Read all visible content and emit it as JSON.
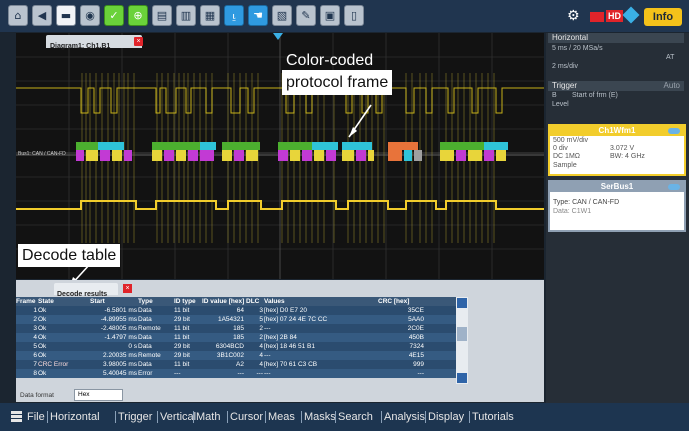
{
  "toolbar": {
    "buttons": [
      {
        "icon": "home-icon",
        "glyph": "⌂"
      },
      {
        "icon": "back-icon",
        "glyph": "◀"
      },
      {
        "icon": "folder-icon",
        "glyph": "▬"
      },
      {
        "icon": "camera-icon",
        "glyph": "◉"
      },
      {
        "icon": "autoset-icon",
        "glyph": "✓"
      },
      {
        "icon": "zoom-icon",
        "glyph": "⊕"
      },
      {
        "icon": "measure-icon",
        "glyph": "▤"
      },
      {
        "icon": "histogram-icon",
        "glyph": "▥"
      },
      {
        "icon": "copy-icon",
        "glyph": "▦"
      },
      {
        "icon": "cursor-icon",
        "glyph": "⍸"
      },
      {
        "icon": "hand-icon",
        "glyph": "☚"
      },
      {
        "icon": "mask-icon",
        "glyph": "▧"
      },
      {
        "icon": "draw-icon",
        "glyph": "✎"
      },
      {
        "icon": "save-icon",
        "glyph": "▣"
      },
      {
        "icon": "delete-icon",
        "glyph": "▯"
      }
    ],
    "settings_glyph": "⚙",
    "hd_label": "HD",
    "info_label": "Info"
  },
  "diagram": {
    "tab_title": "Diagram1: Ch1,B1",
    "close_glyph": "×"
  },
  "channel_label": "Bus1: CAN / CAN-FD",
  "time_labels": [
    "",
    "",
    "",
    "",
    "",
    "",
    "",
    "",
    "",
    ""
  ],
  "callouts": {
    "frame_line1": "Color-coded",
    "frame_line2": "protocol frame",
    "table": "Decode table"
  },
  "decode": {
    "tab_title": "Decode results B1",
    "columns": [
      "Frame",
      "State",
      "Start",
      "Type",
      "ID type",
      "ID value [hex]",
      "DLC",
      "Values",
      "CRC [hex]"
    ],
    "rows": [
      [
        "1",
        "Ok",
        "-6.5801 ms",
        "Data",
        "11 bit",
        "64",
        "3",
        "[hex] D0 E7 20",
        "35CE"
      ],
      [
        "2",
        "Ok",
        "-4.89955 ms",
        "Data",
        "29 bit",
        "1A54321",
        "5",
        "[hex] 07 24 4E 7C CC",
        "5AA0"
      ],
      [
        "3",
        "Ok",
        "-2.48005 ms",
        "Remote",
        "11 bit",
        "185",
        "2",
        "---",
        "2C0E"
      ],
      [
        "4",
        "Ok",
        "-1.4797 ms",
        "Data",
        "11 bit",
        "185",
        "2",
        "[hex] 2B 84",
        "450B"
      ],
      [
        "5",
        "Ok",
        "0 s",
        "Data",
        "29 bit",
        "6304BCD",
        "4",
        "[hex] 18 46 51 B1",
        "7324"
      ],
      [
        "6",
        "Ok",
        "2.20035 ms",
        "Remote",
        "29 bit",
        "3B1C002",
        "4",
        "---",
        "4E15"
      ],
      [
        "7",
        "CRC Error",
        "3.98005 ms",
        "Data",
        "11 bit",
        "A2",
        "4",
        "[hex] 70 61 C3 CB",
        "999"
      ],
      [
        "8",
        "Ok",
        "5.40045 ms",
        "Error",
        "---",
        "---",
        "---",
        "---",
        "---"
      ]
    ],
    "format_label": "Data format",
    "format_value": "Hex"
  },
  "panel": {
    "horizontal_title": "Horizontal",
    "horizontal_lines": [
      "5 ms / 20 MSa/s",
      "",
      "2 ms/div",
      ""
    ],
    "horizontal_right": "AT",
    "trigger_title": "Trigger",
    "trigger_mode": "Auto",
    "trigger_lines": [
      "B",
      "Level"
    ],
    "trigger_detail": "Start of frm (E)",
    "ch1": {
      "title": "Ch1Wfm1",
      "scale": "500 mV/div",
      "offset_label": "0 div",
      "offset_value": "3.072 V",
      "coupling": "DC 1MΩ",
      "bw": "BW: 4 GHz",
      "mode": "Sample"
    },
    "serbus": {
      "title": "SerBus1",
      "type_line": "Type: CAN / CAN-FD",
      "data_line": "Data: C1W1"
    }
  },
  "menu": [
    "File",
    "Horizontal",
    "Trigger",
    "Vertical",
    "Math",
    "Cursor",
    "Meas",
    "Masks",
    "Search",
    "Analysis",
    "Display",
    "Tutorials"
  ],
  "colors": {
    "accent_yellow": "#f2cd2c",
    "frame_green": "#4caf2f",
    "frame_cyan": "#2fc3d8",
    "frame_magenta": "#c23ad4",
    "frame_orange": "#e8733a",
    "error_red": "#e0242a"
  }
}
